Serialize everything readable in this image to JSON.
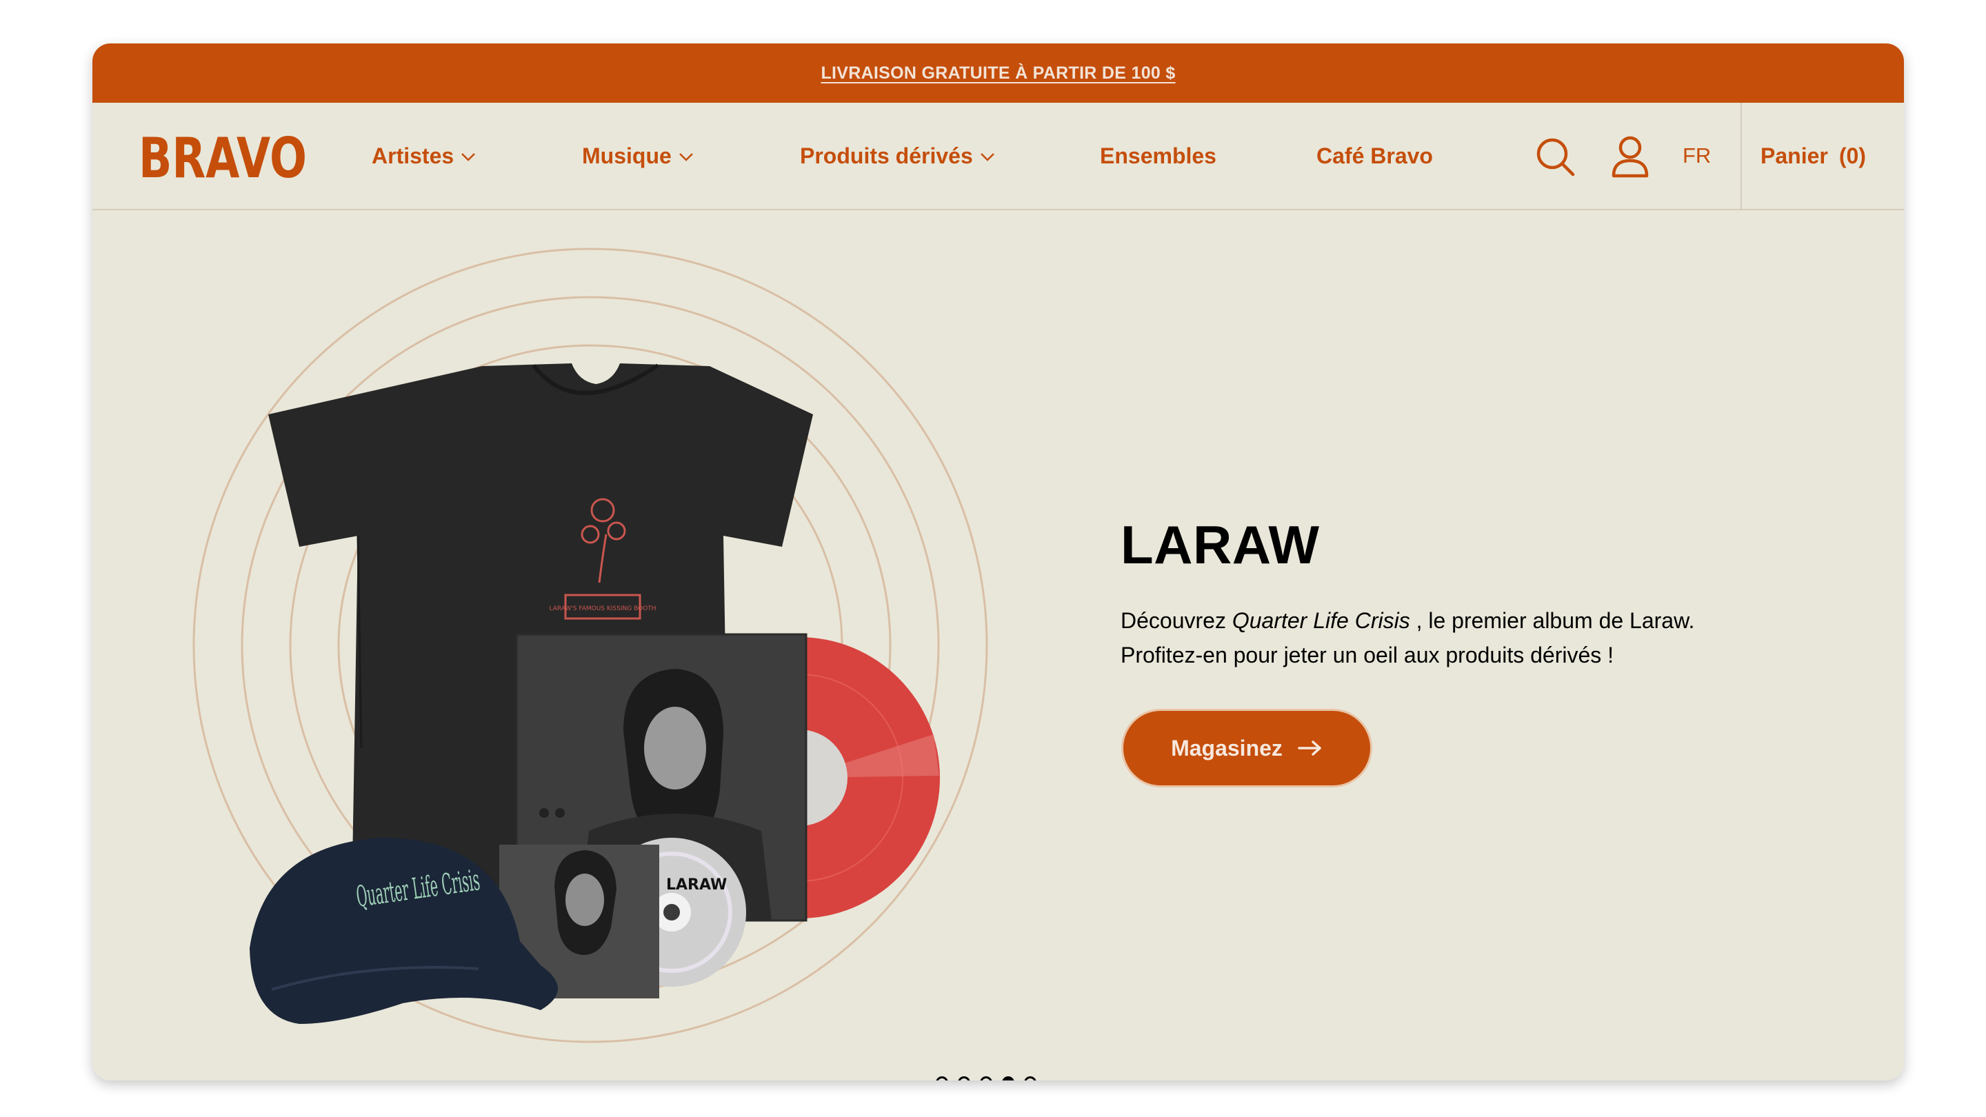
{
  "promo_banner": {
    "text": "LIVRAISON GRATUITE À PARTIR DE 100 $"
  },
  "header": {
    "logo_text": "BRAVO",
    "nav": [
      {
        "label": "Artistes",
        "has_dropdown": true
      },
      {
        "label": "Musique",
        "has_dropdown": true
      },
      {
        "label": "Produits dérivés",
        "has_dropdown": true
      },
      {
        "label": "Ensembles",
        "has_dropdown": false
      },
      {
        "label": "Café Bravo",
        "has_dropdown": false
      }
    ],
    "icons": {
      "search": "search-icon",
      "account": "user-icon"
    },
    "language": "FR",
    "cart": {
      "label": "Panier",
      "count": "(0)"
    }
  },
  "hero": {
    "title": "LARAW",
    "description_prefix": "Découvrez",
    "album_title": "Quarter Life Crisis",
    "description_suffix": ", le premier album de Laraw.",
    "description_line2": "Profitez-en pour jeter un oeil aux produits dérivés !",
    "cta_label": "Magasinez",
    "product_texts": {
      "cap": "Quarter Life Crisis",
      "cd": "LARAW",
      "shirt_label": "LARAW'S FAMOUS KISSING BOOTH"
    }
  },
  "carousel": {
    "slide_count": 5,
    "active_index": 3
  },
  "colors": {
    "brand": "#c54e0b",
    "background": "#e9e7d9",
    "text": "#000000"
  }
}
